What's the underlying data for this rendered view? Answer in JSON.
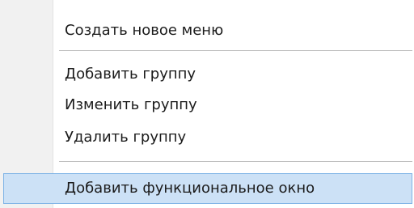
{
  "menu": {
    "items": [
      {
        "label": "Создать новое меню"
      },
      {
        "label": "Добавить группу"
      },
      {
        "label": "Изменить группу"
      },
      {
        "label": "Удалить группу"
      },
      {
        "label": "Добавить функциональное окно",
        "state": "hovered"
      }
    ]
  },
  "colors": {
    "highlight_background": "#cce1f6",
    "highlight_border": "#7eb3e6",
    "gutter": "#f1f1f1",
    "separator": "#bdbdbd"
  }
}
